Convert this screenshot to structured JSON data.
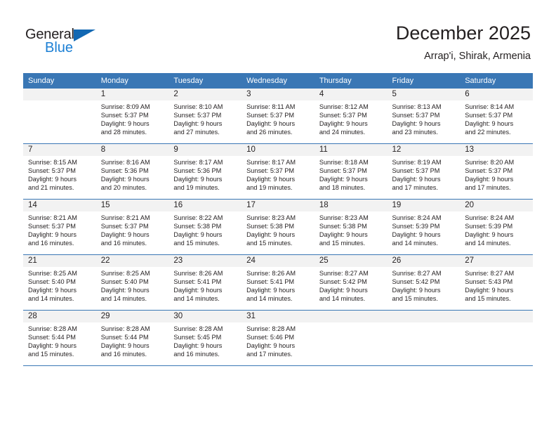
{
  "brand": {
    "name_part1": "General",
    "name_part2": "Blue",
    "accent_color": "#1268b3",
    "blue_text_color": "#1b7fd4"
  },
  "header": {
    "title": "December 2025",
    "subtitle": "Arrap'i, Shirak, Armenia",
    "header_bg_color": "#3a77b5"
  },
  "weekdays": [
    "Sunday",
    "Monday",
    "Tuesday",
    "Wednesday",
    "Thursday",
    "Friday",
    "Saturday"
  ],
  "weeks": [
    [
      {
        "day": "",
        "sunrise": "",
        "sunset": "",
        "daylight_line1": "",
        "daylight_line2": ""
      },
      {
        "day": "1",
        "sunrise": "Sunrise: 8:09 AM",
        "sunset": "Sunset: 5:37 PM",
        "daylight_line1": "Daylight: 9 hours",
        "daylight_line2": "and 28 minutes."
      },
      {
        "day": "2",
        "sunrise": "Sunrise: 8:10 AM",
        "sunset": "Sunset: 5:37 PM",
        "daylight_line1": "Daylight: 9 hours",
        "daylight_line2": "and 27 minutes."
      },
      {
        "day": "3",
        "sunrise": "Sunrise: 8:11 AM",
        "sunset": "Sunset: 5:37 PM",
        "daylight_line1": "Daylight: 9 hours",
        "daylight_line2": "and 26 minutes."
      },
      {
        "day": "4",
        "sunrise": "Sunrise: 8:12 AM",
        "sunset": "Sunset: 5:37 PM",
        "daylight_line1": "Daylight: 9 hours",
        "daylight_line2": "and 24 minutes."
      },
      {
        "day": "5",
        "sunrise": "Sunrise: 8:13 AM",
        "sunset": "Sunset: 5:37 PM",
        "daylight_line1": "Daylight: 9 hours",
        "daylight_line2": "and 23 minutes."
      },
      {
        "day": "6",
        "sunrise": "Sunrise: 8:14 AM",
        "sunset": "Sunset: 5:37 PM",
        "daylight_line1": "Daylight: 9 hours",
        "daylight_line2": "and 22 minutes."
      }
    ],
    [
      {
        "day": "7",
        "sunrise": "Sunrise: 8:15 AM",
        "sunset": "Sunset: 5:37 PM",
        "daylight_line1": "Daylight: 9 hours",
        "daylight_line2": "and 21 minutes."
      },
      {
        "day": "8",
        "sunrise": "Sunrise: 8:16 AM",
        "sunset": "Sunset: 5:36 PM",
        "daylight_line1": "Daylight: 9 hours",
        "daylight_line2": "and 20 minutes."
      },
      {
        "day": "9",
        "sunrise": "Sunrise: 8:17 AM",
        "sunset": "Sunset: 5:36 PM",
        "daylight_line1": "Daylight: 9 hours",
        "daylight_line2": "and 19 minutes."
      },
      {
        "day": "10",
        "sunrise": "Sunrise: 8:17 AM",
        "sunset": "Sunset: 5:37 PM",
        "daylight_line1": "Daylight: 9 hours",
        "daylight_line2": "and 19 minutes."
      },
      {
        "day": "11",
        "sunrise": "Sunrise: 8:18 AM",
        "sunset": "Sunset: 5:37 PM",
        "daylight_line1": "Daylight: 9 hours",
        "daylight_line2": "and 18 minutes."
      },
      {
        "day": "12",
        "sunrise": "Sunrise: 8:19 AM",
        "sunset": "Sunset: 5:37 PM",
        "daylight_line1": "Daylight: 9 hours",
        "daylight_line2": "and 17 minutes."
      },
      {
        "day": "13",
        "sunrise": "Sunrise: 8:20 AM",
        "sunset": "Sunset: 5:37 PM",
        "daylight_line1": "Daylight: 9 hours",
        "daylight_line2": "and 17 minutes."
      }
    ],
    [
      {
        "day": "14",
        "sunrise": "Sunrise: 8:21 AM",
        "sunset": "Sunset: 5:37 PM",
        "daylight_line1": "Daylight: 9 hours",
        "daylight_line2": "and 16 minutes."
      },
      {
        "day": "15",
        "sunrise": "Sunrise: 8:21 AM",
        "sunset": "Sunset: 5:37 PM",
        "daylight_line1": "Daylight: 9 hours",
        "daylight_line2": "and 16 minutes."
      },
      {
        "day": "16",
        "sunrise": "Sunrise: 8:22 AM",
        "sunset": "Sunset: 5:38 PM",
        "daylight_line1": "Daylight: 9 hours",
        "daylight_line2": "and 15 minutes."
      },
      {
        "day": "17",
        "sunrise": "Sunrise: 8:23 AM",
        "sunset": "Sunset: 5:38 PM",
        "daylight_line1": "Daylight: 9 hours",
        "daylight_line2": "and 15 minutes."
      },
      {
        "day": "18",
        "sunrise": "Sunrise: 8:23 AM",
        "sunset": "Sunset: 5:38 PM",
        "daylight_line1": "Daylight: 9 hours",
        "daylight_line2": "and 15 minutes."
      },
      {
        "day": "19",
        "sunrise": "Sunrise: 8:24 AM",
        "sunset": "Sunset: 5:39 PM",
        "daylight_line1": "Daylight: 9 hours",
        "daylight_line2": "and 14 minutes."
      },
      {
        "day": "20",
        "sunrise": "Sunrise: 8:24 AM",
        "sunset": "Sunset: 5:39 PM",
        "daylight_line1": "Daylight: 9 hours",
        "daylight_line2": "and 14 minutes."
      }
    ],
    [
      {
        "day": "21",
        "sunrise": "Sunrise: 8:25 AM",
        "sunset": "Sunset: 5:40 PM",
        "daylight_line1": "Daylight: 9 hours",
        "daylight_line2": "and 14 minutes."
      },
      {
        "day": "22",
        "sunrise": "Sunrise: 8:25 AM",
        "sunset": "Sunset: 5:40 PM",
        "daylight_line1": "Daylight: 9 hours",
        "daylight_line2": "and 14 minutes."
      },
      {
        "day": "23",
        "sunrise": "Sunrise: 8:26 AM",
        "sunset": "Sunset: 5:41 PM",
        "daylight_line1": "Daylight: 9 hours",
        "daylight_line2": "and 14 minutes."
      },
      {
        "day": "24",
        "sunrise": "Sunrise: 8:26 AM",
        "sunset": "Sunset: 5:41 PM",
        "daylight_line1": "Daylight: 9 hours",
        "daylight_line2": "and 14 minutes."
      },
      {
        "day": "25",
        "sunrise": "Sunrise: 8:27 AM",
        "sunset": "Sunset: 5:42 PM",
        "daylight_line1": "Daylight: 9 hours",
        "daylight_line2": "and 14 minutes."
      },
      {
        "day": "26",
        "sunrise": "Sunrise: 8:27 AM",
        "sunset": "Sunset: 5:42 PM",
        "daylight_line1": "Daylight: 9 hours",
        "daylight_line2": "and 15 minutes."
      },
      {
        "day": "27",
        "sunrise": "Sunrise: 8:27 AM",
        "sunset": "Sunset: 5:43 PM",
        "daylight_line1": "Daylight: 9 hours",
        "daylight_line2": "and 15 minutes."
      }
    ],
    [
      {
        "day": "28",
        "sunrise": "Sunrise: 8:28 AM",
        "sunset": "Sunset: 5:44 PM",
        "daylight_line1": "Daylight: 9 hours",
        "daylight_line2": "and 15 minutes."
      },
      {
        "day": "29",
        "sunrise": "Sunrise: 8:28 AM",
        "sunset": "Sunset: 5:44 PM",
        "daylight_line1": "Daylight: 9 hours",
        "daylight_line2": "and 16 minutes."
      },
      {
        "day": "30",
        "sunrise": "Sunrise: 8:28 AM",
        "sunset": "Sunset: 5:45 PM",
        "daylight_line1": "Daylight: 9 hours",
        "daylight_line2": "and 16 minutes."
      },
      {
        "day": "31",
        "sunrise": "Sunrise: 8:28 AM",
        "sunset": "Sunset: 5:46 PM",
        "daylight_line1": "Daylight: 9 hours",
        "daylight_line2": "and 17 minutes."
      },
      {
        "day": "",
        "sunrise": "",
        "sunset": "",
        "daylight_line1": "",
        "daylight_line2": ""
      },
      {
        "day": "",
        "sunrise": "",
        "sunset": "",
        "daylight_line1": "",
        "daylight_line2": ""
      },
      {
        "day": "",
        "sunrise": "",
        "sunset": "",
        "daylight_line1": "",
        "daylight_line2": ""
      }
    ]
  ]
}
